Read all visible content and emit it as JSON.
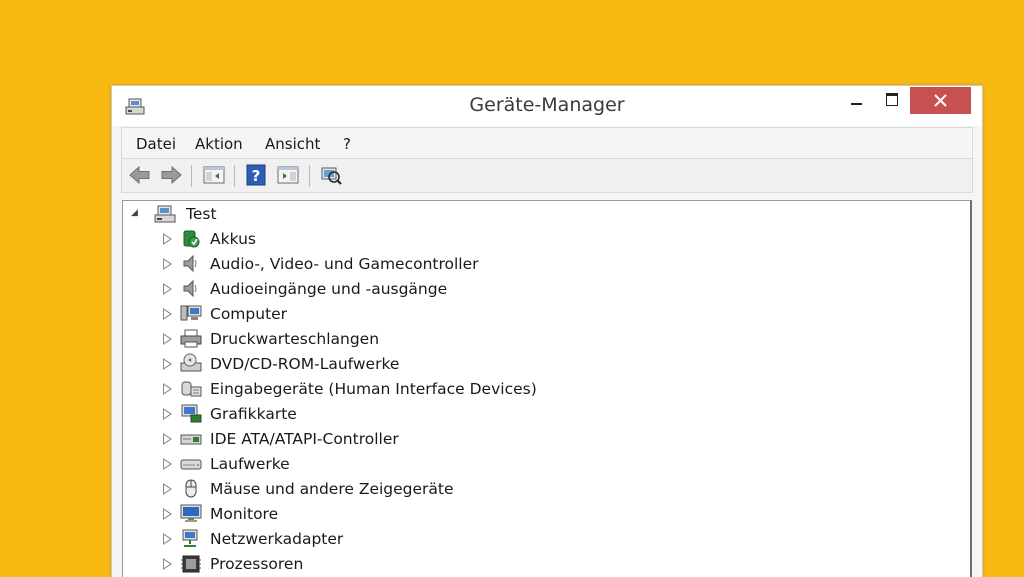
{
  "window": {
    "title": "Geräte-Manager",
    "close_color": "#c75050",
    "desktop_color": "#f7b912"
  },
  "menu": {
    "items": [
      "Datei",
      "Aktion",
      "Ansicht",
      "?"
    ]
  },
  "toolbar": {
    "icons": [
      "back-arrow-icon",
      "forward-arrow-icon",
      "show-hide-console-tree-icon",
      "help-icon",
      "properties-panel-icon",
      "scan-hardware-icon"
    ]
  },
  "tree": {
    "root": {
      "label": "Test",
      "expanded": true
    },
    "nodes": [
      {
        "label": "Akkus",
        "icon": "battery-icon"
      },
      {
        "label": "Audio-, Video- und Gamecontroller",
        "icon": "speaker-icon"
      },
      {
        "label": "Audioeingänge und -ausgänge",
        "icon": "speaker-icon"
      },
      {
        "label": "Computer",
        "icon": "computer-icon"
      },
      {
        "label": "Druckwarteschlangen",
        "icon": "printer-icon"
      },
      {
        "label": "DVD/CD-ROM-Laufwerke",
        "icon": "dvd-drive-icon"
      },
      {
        "label": "Eingabegeräte (Human Interface Devices)",
        "icon": "hid-icon"
      },
      {
        "label": "Grafikkarte",
        "icon": "display-adapter-icon"
      },
      {
        "label": "IDE ATA/ATAPI-Controller",
        "icon": "ide-controller-icon"
      },
      {
        "label": "Laufwerke",
        "icon": "disk-drive-icon"
      },
      {
        "label": "Mäuse und andere Zeigegeräte",
        "icon": "mouse-icon"
      },
      {
        "label": "Monitore",
        "icon": "monitor-icon"
      },
      {
        "label": "Netzwerkadapter",
        "icon": "network-adapter-icon"
      },
      {
        "label": "Prozessoren",
        "icon": "processor-icon"
      }
    ]
  }
}
